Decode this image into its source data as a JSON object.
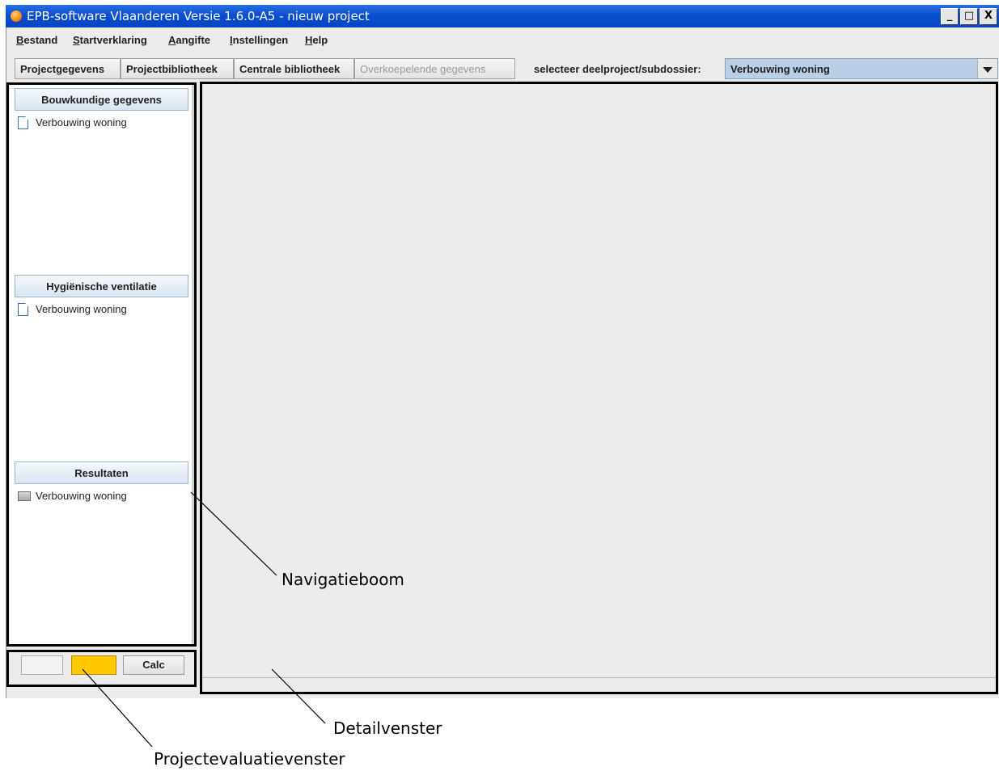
{
  "window": {
    "title": "EPB-software Vlaanderen Versie 1.6.0-A5 - nieuw project",
    "buttons": {
      "minimize": "_",
      "maximize": "□",
      "close": "X"
    }
  },
  "menubar": {
    "items": [
      {
        "mnemonic": "B",
        "rest": "estand"
      },
      {
        "mnemonic": "S",
        "rest": "tartverklaring"
      },
      {
        "mnemonic": "A",
        "rest": "angifte"
      },
      {
        "mnemonic": "I",
        "rest": "nstellingen"
      },
      {
        "mnemonic": "H",
        "rest": "elp"
      }
    ]
  },
  "toolbar": {
    "tabs": [
      {
        "label": "Projectgegevens",
        "enabled": true
      },
      {
        "label": "Projectbibliotheek",
        "enabled": true
      },
      {
        "label": "Centrale bibliotheek",
        "enabled": true
      },
      {
        "label": "Overkoepelende gegevens",
        "enabled": false
      }
    ],
    "select_label": "selecteer deelproject/subdossier:",
    "select_value": "Verbouwing woning"
  },
  "navigation": {
    "sections": [
      {
        "header": "Bouwkundige gegevens",
        "item": "Verbouwing woning",
        "icon": "document-icon"
      },
      {
        "header": "Hygiënische ventilatie",
        "item": "Verbouwing woning",
        "icon": "document-icon"
      },
      {
        "header": "Resultaten",
        "item": "Verbouwing woning",
        "icon": "folder-icon"
      }
    ]
  },
  "evaluation": {
    "calc_label": "Calc",
    "indicator_color": "#ffc800"
  },
  "annotations": {
    "navigatieboom": "Navigatieboom",
    "detailvenster": "Detailvenster",
    "projectevaluatievenster": "Projectevaluatievenster"
  }
}
